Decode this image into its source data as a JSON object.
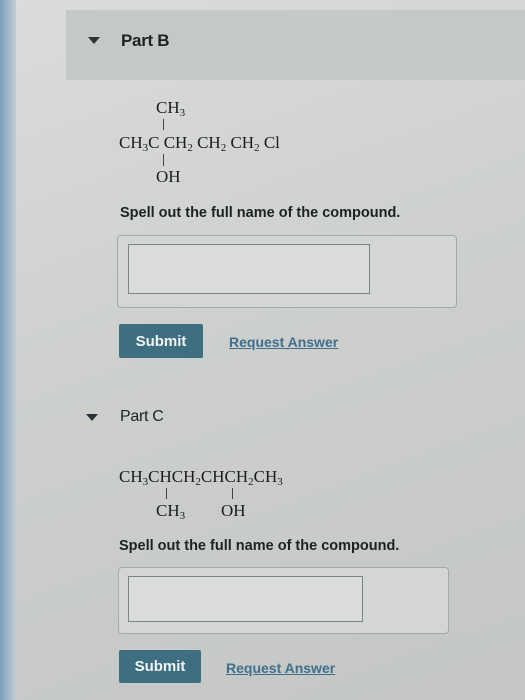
{
  "colors": {
    "accent_button": "#3d6f80",
    "link": "#3e6f8e",
    "header_band": "#c4c8c7"
  },
  "part_b": {
    "title": "Part B",
    "caret_icon": "caret-down-icon",
    "formula": {
      "top_substituent": "CH",
      "top_substituent_sub": "3",
      "chain_segments": [
        {
          "text": "CH",
          "sub": "3"
        },
        {
          "text": "C",
          "sub": ""
        },
        {
          "text": "CH",
          "sub": "2"
        },
        {
          "text": "CH",
          "sub": "2"
        },
        {
          "text": "CH",
          "sub": "2"
        },
        {
          "text": "Cl",
          "sub": ""
        }
      ],
      "bottom_substituent": "OH"
    },
    "prompt": "Spell out the full name of the compound.",
    "answer_value": "",
    "submit_label": "Submit",
    "request_answer_label": "Request Answer"
  },
  "part_c": {
    "title": "Part C",
    "caret_icon": "caret-down-icon",
    "formula": {
      "chain_segments": [
        {
          "text": "CH",
          "sub": "3"
        },
        {
          "text": "CH",
          "sub": ""
        },
        {
          "text": "CH",
          "sub": "2"
        },
        {
          "text": "CH",
          "sub": ""
        },
        {
          "text": "CH",
          "sub": "2"
        },
        {
          "text": "CH",
          "sub": "3"
        }
      ],
      "bottom_substituent_left": "CH",
      "bottom_substituent_left_sub": "3",
      "bottom_substituent_right": "OH"
    },
    "prompt": "Spell out the full name of the compound.",
    "answer_value": "",
    "submit_label": "Submit",
    "request_answer_label": "Request Answer"
  }
}
